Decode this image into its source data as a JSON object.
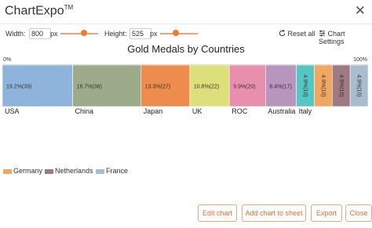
{
  "app": {
    "title": "ChartExpo",
    "trademark": "TM",
    "close_glyph": "✕"
  },
  "controls": {
    "width_label": "Width:",
    "width_value": "800",
    "width_unit": "px",
    "height_label": "Height:",
    "height_value": "525",
    "height_unit": "px",
    "reset_label": "Reset all",
    "settings_label": "Chart Settings"
  },
  "chart_data": {
    "type": "bar",
    "subtype": "100% stacked horizontal bar",
    "title": "Gold Medals by Countries",
    "axis_start_label": "0%",
    "axis_end_label": "100%",
    "series": [
      {
        "name": "USA",
        "value": 39,
        "percent": 19.2,
        "label": "19.2%(39)",
        "color": "#8fb4dc"
      },
      {
        "name": "China",
        "value": 38,
        "percent": 18.7,
        "label": "18.7%(38)",
        "color": "#9cac8a"
      },
      {
        "name": "Japan",
        "value": 27,
        "percent": 13.3,
        "label": "13.3%(27)",
        "color": "#ee8c4e"
      },
      {
        "name": "UK",
        "value": 22,
        "percent": 10.8,
        "label": "10.8%(22)",
        "color": "#dde07a"
      },
      {
        "name": "ROC",
        "value": 20,
        "percent": 9.9,
        "label": "9.9%(20)",
        "color": "#e98fae"
      },
      {
        "name": "Australia",
        "value": 17,
        "percent": 8.4,
        "label": "8.4%(17)",
        "color": "#b895bd"
      },
      {
        "name": "Italy",
        "value": 10,
        "percent": 4.9,
        "label": "4.9%(10)",
        "color": "#56c6c4"
      },
      {
        "name": "Germany",
        "value": 10,
        "percent": 4.9,
        "label": "4.9%(10)",
        "color": "#f0a860"
      },
      {
        "name": "Netherlands",
        "value": 10,
        "percent": 4.9,
        "label": "4.9%(10)",
        "color": "#9e7a82"
      },
      {
        "name": "France",
        "value": 10,
        "percent": 4.9,
        "label": "4.9%(10)",
        "color": "#a9bdd0"
      }
    ],
    "category_labels_shown": [
      "USA",
      "China",
      "Japan",
      "UK",
      "ROC",
      "Australia",
      "Italy"
    ],
    "legend": [
      "Germany",
      "Netherlands",
      "France"
    ]
  },
  "footer": {
    "edit_chart": "Edit chart",
    "add_chart": "Add chart to sheet",
    "export": "Export",
    "close": "Close"
  },
  "colors": {
    "accent": "#e46f2f",
    "accent_border": "#f0a47d"
  }
}
